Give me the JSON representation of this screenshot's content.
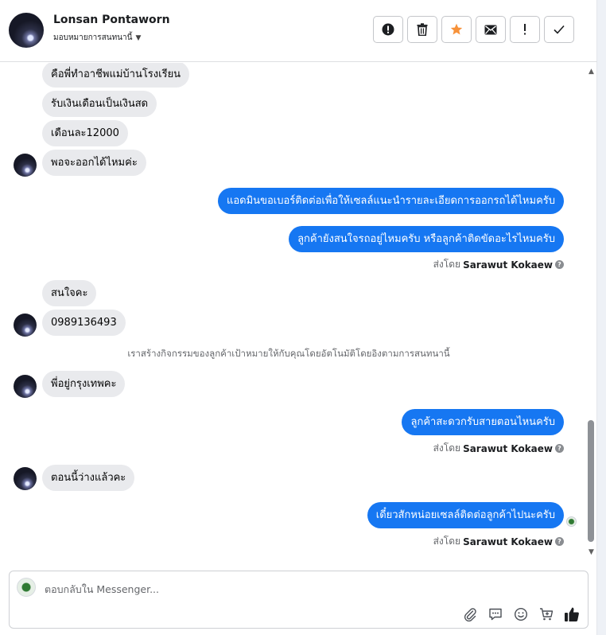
{
  "header": {
    "contact_name": "Lonsan Pontaworn",
    "assign_label": "มอบหมายการสนทนานี้",
    "actions": [
      {
        "id": "spam",
        "icon": "alert-circle-icon"
      },
      {
        "id": "delete",
        "icon": "trash-icon"
      },
      {
        "id": "star",
        "icon": "star-icon",
        "color": "#f7923a"
      },
      {
        "id": "mark-unread",
        "icon": "envelope-icon"
      },
      {
        "id": "follow-up",
        "icon": "exclamation-icon"
      },
      {
        "id": "done",
        "icon": "check-icon"
      }
    ]
  },
  "messages": {
    "m1": "คือพี่ทำอาชีพแม่บ้านโรงเรียน",
    "m2": "รับเงินเดือนเป็นเงินสด",
    "m3": "เดือนละ12000",
    "m4": "พอจะออกได้ไหมค่ะ",
    "m5": "แอดมินขอเบอร์ติดต่อเพื่อให้เซลล์แนะนำรายละเอียดการออกรถได้ไหมครับ",
    "m6": "ลูกค้ายังสนใจรถอยู่ไหมครับ หรือลูกค้าติดขัดอะไรไหมครับ",
    "m7": "สนใจคะ",
    "m8": "0989136493",
    "m9": "พี่อยู่กรุงเทพคะ",
    "m10": "ลูกค้าสะดวกรับสายตอนไหนครับ",
    "m11": "ตอนนี้ว่างแล้วคะ",
    "m12": "เดี๋ยวสักหน่อยเซลล์ติดต่อลูกค้าไปนะครับ"
  },
  "sent_by": {
    "prefix": "ส่งโดย",
    "agent": "Sarawut Kokaew",
    "help_glyph": "?"
  },
  "system_note": "เราสร้างกิจกรรมของลูกค้าเป้าหมายให้กับคุณโดยอัตโนมัติโดยอิงตามการสนทนานี้",
  "composer": {
    "placeholder": "ตอบกลับใน Messenger...",
    "value": "",
    "tools": [
      "attach-icon",
      "chat-bubble-icon",
      "emoji-icon",
      "cart-icon",
      "like-icon"
    ]
  },
  "colors": {
    "outgoing_bubble": "#1677f2",
    "incoming_bubble": "#e9eaed",
    "star": "#f7923a"
  }
}
